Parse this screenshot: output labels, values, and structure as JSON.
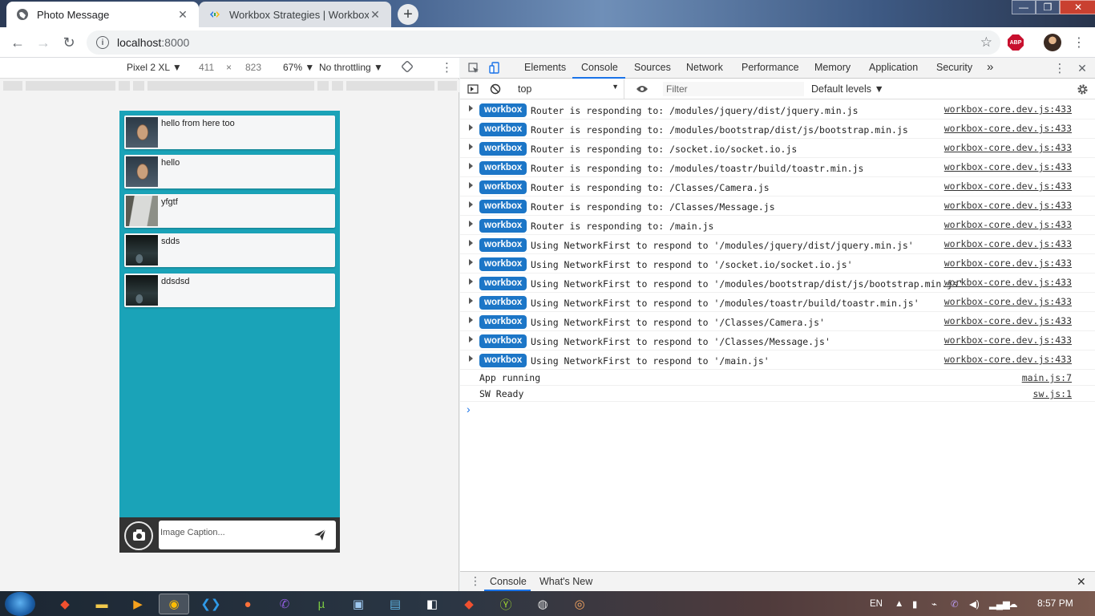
{
  "browser": {
    "tabs": [
      {
        "title": "Photo Message",
        "active": true,
        "favicon": "globe-icon"
      },
      {
        "title": "Workbox Strategies  |  Workbox",
        "active": false,
        "favicon": "workbox-icon"
      }
    ],
    "address": {
      "host": "localhost",
      "port": ":8000"
    },
    "extension_label": "ABP"
  },
  "device_toolbar": {
    "device": "Pixel 2 XL ▼",
    "width": "411",
    "times": "×",
    "height": "823",
    "zoom": "67% ▼",
    "throttling": "No throttling ▼"
  },
  "app": {
    "messages": [
      {
        "text": "hello from here too",
        "thumb": "face"
      },
      {
        "text": "hello",
        "thumb": "face"
      },
      {
        "text": "yfgtf",
        "thumb": "wall"
      },
      {
        "text": "sdds",
        "thumb": "dark"
      },
      {
        "text": "ddsdsd",
        "thumb": "dark"
      }
    ],
    "caption_placeholder": "Image Caption...",
    "colors": {
      "background": "#1aa3b8",
      "composer": "#333333"
    }
  },
  "devtools": {
    "tabs": [
      "Elements",
      "Console",
      "Sources",
      "Network",
      "Performance",
      "Memory",
      "Application",
      "Security",
      "»"
    ],
    "active_tab": "Console",
    "context": "top",
    "filter_placeholder": "Filter",
    "levels": "Default levels ▼",
    "log": [
      {
        "badge": "workbox",
        "text": "Router is responding to: /modules/jquery/dist/jquery.min.js",
        "src": "workbox-core.dev.js:433"
      },
      {
        "badge": "workbox",
        "text": "Router is responding to: /modules/bootstrap/dist/js/bootstrap.min.js",
        "src": "workbox-core.dev.js:433"
      },
      {
        "badge": "workbox",
        "text": "Router is responding to: /socket.io/socket.io.js",
        "src": "workbox-core.dev.js:433"
      },
      {
        "badge": "workbox",
        "text": "Router is responding to: /modules/toastr/build/toastr.min.js",
        "src": "workbox-core.dev.js:433"
      },
      {
        "badge": "workbox",
        "text": "Router is responding to: /Classes/Camera.js",
        "src": "workbox-core.dev.js:433"
      },
      {
        "badge": "workbox",
        "text": "Router is responding to: /Classes/Message.js",
        "src": "workbox-core.dev.js:433"
      },
      {
        "badge": "workbox",
        "text": "Router is responding to: /main.js",
        "src": "workbox-core.dev.js:433"
      },
      {
        "badge": "workbox",
        "text": "Using NetworkFirst to respond to '/modules/jquery/dist/jquery.min.js'",
        "src": "workbox-core.dev.js:433"
      },
      {
        "badge": "workbox",
        "text": "Using NetworkFirst to respond to '/socket.io/socket.io.js'",
        "src": "workbox-core.dev.js:433"
      },
      {
        "badge": "workbox",
        "text": "Using NetworkFirst to respond to '/modules/bootstrap/dist/js/bootstrap.min.js'",
        "src": "workbox-core.dev.js:433"
      },
      {
        "badge": "workbox",
        "text": "Using NetworkFirst to respond to '/modules/toastr/build/toastr.min.js'",
        "src": "workbox-core.dev.js:433"
      },
      {
        "badge": "workbox",
        "text": "Using NetworkFirst to respond to '/Classes/Camera.js'",
        "src": "workbox-core.dev.js:433"
      },
      {
        "badge": "workbox",
        "text": "Using NetworkFirst to respond to '/Classes/Message.js'",
        "src": "workbox-core.dev.js:433"
      },
      {
        "badge": "workbox",
        "text": "Using NetworkFirst to respond to '/main.js'",
        "src": "workbox-core.dev.js:433"
      },
      {
        "badge": "",
        "text": "App running",
        "src": "main.js:7"
      },
      {
        "badge": "",
        "text": "SW Ready",
        "src": "sw.js:1"
      }
    ],
    "drawer_tabs": [
      "Console",
      "What's New"
    ],
    "colors": {
      "badge": "#1c76c7",
      "accent": "#1a73e8"
    }
  },
  "taskbar": {
    "language": "EN",
    "time": "8:57 PM",
    "pinned": [
      "git-icon",
      "folder-icon",
      "media-player-icon",
      "chrome-icon",
      "vscode-icon",
      "firefox-icon",
      "viber-icon",
      "utorrent-icon",
      "control-panel-icon",
      "terminal-icon",
      "notes-icon",
      "git-gui-icon",
      "app-icon",
      "game-icon",
      "screen-icon"
    ]
  }
}
